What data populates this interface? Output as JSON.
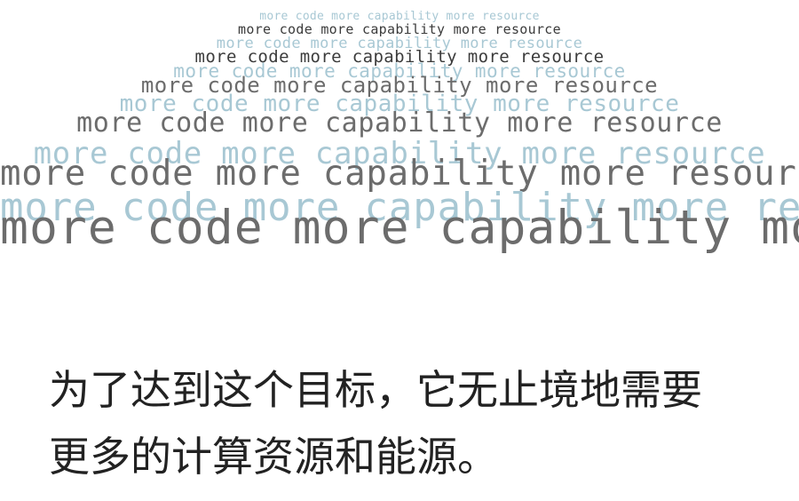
{
  "word_stack": {
    "lines": [
      "more code more capability more resource",
      "more code more capability more resource",
      "more code more capability more resource",
      "more code more capability more resource",
      "more code more capability more resource",
      "more code more capability more resource",
      "more code more capability more resource",
      "more code more capability more resource",
      "more code more capability more resource",
      "more code more capability more resource",
      "more code more capability more resource",
      "more code more capability more resource"
    ],
    "colors": {
      "blue": "#a8c8d4",
      "gray": "#6c6c6c",
      "dark": "#3b3b3b"
    }
  },
  "caption": {
    "line1": "为了达到这个目标，它无止境地需要",
    "line2": "更多的计算资源和能源。"
  }
}
